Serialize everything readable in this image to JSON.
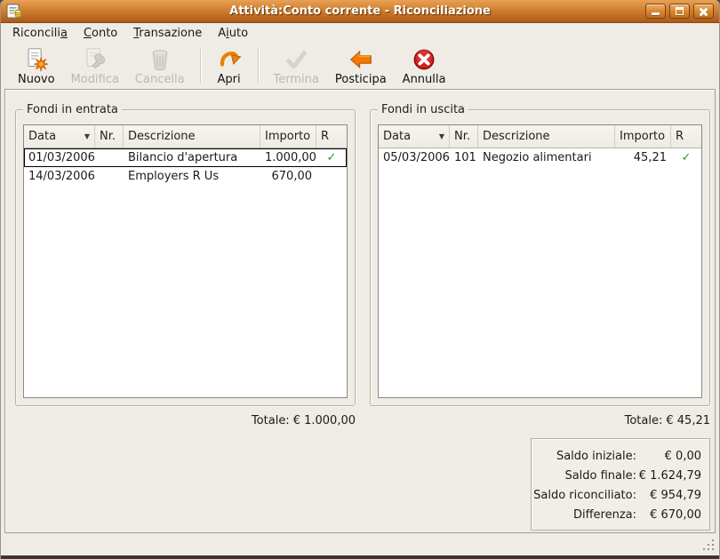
{
  "window": {
    "title": "Attività:Conto corrente - Riconciliazione"
  },
  "menubar": {
    "items": [
      {
        "pre": "Riconcili",
        "key": "a",
        "post": ""
      },
      {
        "pre": "",
        "key": "C",
        "post": "onto"
      },
      {
        "pre": "",
        "key": "T",
        "post": "ransazione"
      },
      {
        "pre": "A",
        "key": "i",
        "post": "uto"
      }
    ]
  },
  "toolbar": {
    "buttons": [
      {
        "label": "Nuovo",
        "enabled": true
      },
      {
        "label": "Modifica",
        "enabled": false
      },
      {
        "label": "Cancella",
        "enabled": false
      },
      {
        "label": "Apri",
        "enabled": true
      },
      {
        "label": "Termina",
        "enabled": false
      },
      {
        "label": "Posticipa",
        "enabled": true
      },
      {
        "label": "Annulla",
        "enabled": true
      }
    ]
  },
  "panels": {
    "inflow": {
      "title": "Fondi in entrata",
      "columns": [
        "Data",
        "Nr.",
        "Descrizione",
        "Importo",
        "R"
      ],
      "rows": [
        {
          "date": "01/03/2006",
          "nr": "",
          "desc": "Bilancio d'apertura",
          "amount": "1.000,00",
          "reconciled": "✓"
        },
        {
          "date": "14/03/2006",
          "nr": "",
          "desc": "Employers R Us",
          "amount": "670,00",
          "reconciled": ""
        }
      ],
      "total_label": "Totale:",
      "total_value": "€ 1.000,00"
    },
    "outflow": {
      "title": "Fondi in uscita",
      "columns": [
        "Data",
        "Nr.",
        "Descrizione",
        "Importo",
        "R"
      ],
      "rows": [
        {
          "date": "05/03/2006",
          "nr": "101",
          "desc": "Negozio alimentari",
          "amount": "45,21",
          "reconciled": "✓"
        }
      ],
      "total_label": "Totale:",
      "total_value": "€ 45,21"
    }
  },
  "summary": {
    "rows": [
      {
        "label": "Saldo iniziale:",
        "value": "€ 0,00"
      },
      {
        "label": "Saldo finale:",
        "value": "€ 1.624,79"
      },
      {
        "label": "Saldo riconciliato:",
        "value": "€ 954,79"
      },
      {
        "label": "Differenza:",
        "value": "€ 670,00"
      }
    ]
  },
  "icons": {
    "sort_desc": "▼",
    "check": "✓"
  },
  "colors": {
    "titlebar_top": "#E8A055",
    "titlebar_bottom": "#A9581A",
    "accent_orange": "#F57900",
    "check_green": "#1E9B1E",
    "cancel_red": "#CC1F1F"
  }
}
